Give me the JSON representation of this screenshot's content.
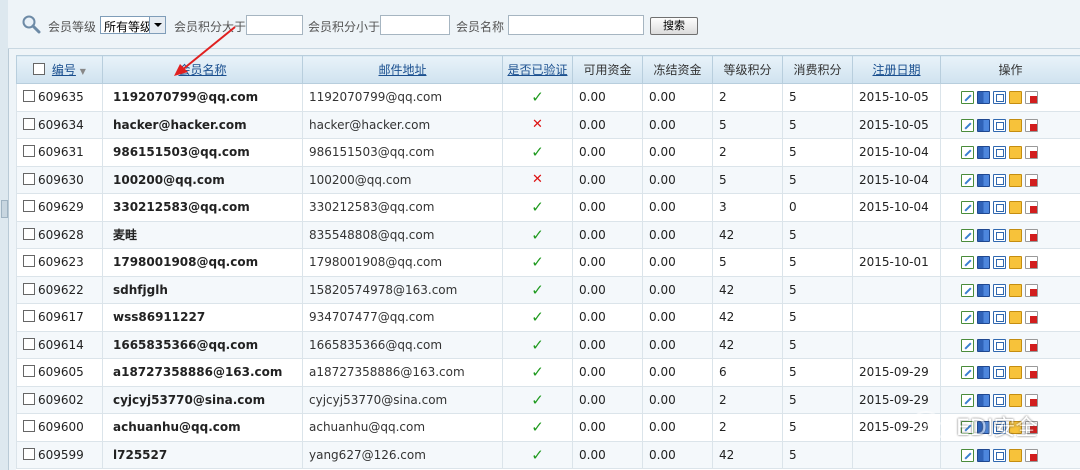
{
  "search": {
    "level_label": "会员等级",
    "level_selected": "所有等级",
    "points_gt_label": "会员积分大于",
    "points_gt_value": "",
    "points_lt_label": "会员积分小于",
    "points_lt_value": "",
    "name_label": "会员名称",
    "name_value": "",
    "search_button": "搜索"
  },
  "table": {
    "headers": {
      "id": "编号",
      "name": "会员名称",
      "email": "邮件地址",
      "verified": "是否已验证",
      "available": "可用资金",
      "frozen": "冻结资金",
      "rank_points": "等级积分",
      "pay_points": "消费积分",
      "reg_date": "注册日期",
      "actions": "操作"
    },
    "rows": [
      {
        "id": "609635",
        "name": "1192070799@qq.com",
        "email": "1192070799@qq.com",
        "verified": true,
        "available": "0.00",
        "frozen": "0.00",
        "rank_points": "2",
        "pay_points": "5",
        "reg_date": "2015-10-05"
      },
      {
        "id": "609634",
        "name": "hacker@hacker.com",
        "email": "hacker@hacker.com",
        "verified": false,
        "available": "0.00",
        "frozen": "0.00",
        "rank_points": "5",
        "pay_points": "5",
        "reg_date": "2015-10-05"
      },
      {
        "id": "609631",
        "name": "986151503@qq.com",
        "email": "986151503@qq.com",
        "verified": true,
        "available": "0.00",
        "frozen": "0.00",
        "rank_points": "2",
        "pay_points": "5",
        "reg_date": "2015-10-04"
      },
      {
        "id": "609630",
        "name": "100200@qq.com",
        "email": "100200@qq.com",
        "verified": false,
        "available": "0.00",
        "frozen": "0.00",
        "rank_points": "5",
        "pay_points": "5",
        "reg_date": "2015-10-04"
      },
      {
        "id": "609629",
        "name": "330212583@qq.com",
        "email": "330212583@qq.com",
        "verified": true,
        "available": "0.00",
        "frozen": "0.00",
        "rank_points": "3",
        "pay_points": "0",
        "reg_date": "2015-10-04"
      },
      {
        "id": "609628",
        "name": "麦畦",
        "email": "835548808@qq.com",
        "verified": true,
        "available": "0.00",
        "frozen": "0.00",
        "rank_points": "42",
        "pay_points": "5",
        "reg_date": ""
      },
      {
        "id": "609623",
        "name": "1798001908@qq.com",
        "email": "1798001908@qq.com",
        "verified": true,
        "available": "0.00",
        "frozen": "0.00",
        "rank_points": "5",
        "pay_points": "5",
        "reg_date": "2015-10-01"
      },
      {
        "id": "609622",
        "name": "sdhfjglh",
        "email": "15820574978@163.com",
        "verified": true,
        "available": "0.00",
        "frozen": "0.00",
        "rank_points": "42",
        "pay_points": "5",
        "reg_date": ""
      },
      {
        "id": "609617",
        "name": "wss86911227",
        "email": "934707477@qq.com",
        "verified": true,
        "available": "0.00",
        "frozen": "0.00",
        "rank_points": "42",
        "pay_points": "5",
        "reg_date": ""
      },
      {
        "id": "609614",
        "name": "1665835366@qq.com",
        "email": "1665835366@qq.com",
        "verified": true,
        "available": "0.00",
        "frozen": "0.00",
        "rank_points": "42",
        "pay_points": "5",
        "reg_date": ""
      },
      {
        "id": "609605",
        "name": "a18727358886@163.com",
        "email": "a18727358886@163.com",
        "verified": true,
        "available": "0.00",
        "frozen": "0.00",
        "rank_points": "6",
        "pay_points": "5",
        "reg_date": "2015-09-29"
      },
      {
        "id": "609602",
        "name": "cyjcyj53770@sina.com",
        "email": "cyjcyj53770@sina.com",
        "verified": true,
        "available": "0.00",
        "frozen": "0.00",
        "rank_points": "2",
        "pay_points": "5",
        "reg_date": "2015-09-29"
      },
      {
        "id": "609600",
        "name": "achuanhu@qq.com",
        "email": "achuanhu@qq.com",
        "verified": true,
        "available": "0.00",
        "frozen": "0.00",
        "rank_points": "2",
        "pay_points": "5",
        "reg_date": "2015-09-29"
      },
      {
        "id": "609599",
        "name": "l725527",
        "email": "yang627@126.com",
        "verified": true,
        "available": "0.00",
        "frozen": "0.00",
        "rank_points": "42",
        "pay_points": "5",
        "reg_date": ""
      }
    ]
  },
  "icons": {
    "search": "magnifier-icon",
    "verified_yes": "check-icon",
    "verified_no": "cross-icon",
    "actions": [
      "edit-icon",
      "view-icon",
      "copy-icon",
      "note-icon",
      "delete-icon"
    ]
  },
  "colors": {
    "check": "#1f9a1f",
    "cross": "#dd1111",
    "header_link": "#1a4f8f",
    "arrow": "#e02020"
  },
  "symbols": {
    "check": "✓",
    "cross": "✕",
    "sort_desc": "▼"
  },
  "watermark": {
    "text": "EDI安全"
  }
}
